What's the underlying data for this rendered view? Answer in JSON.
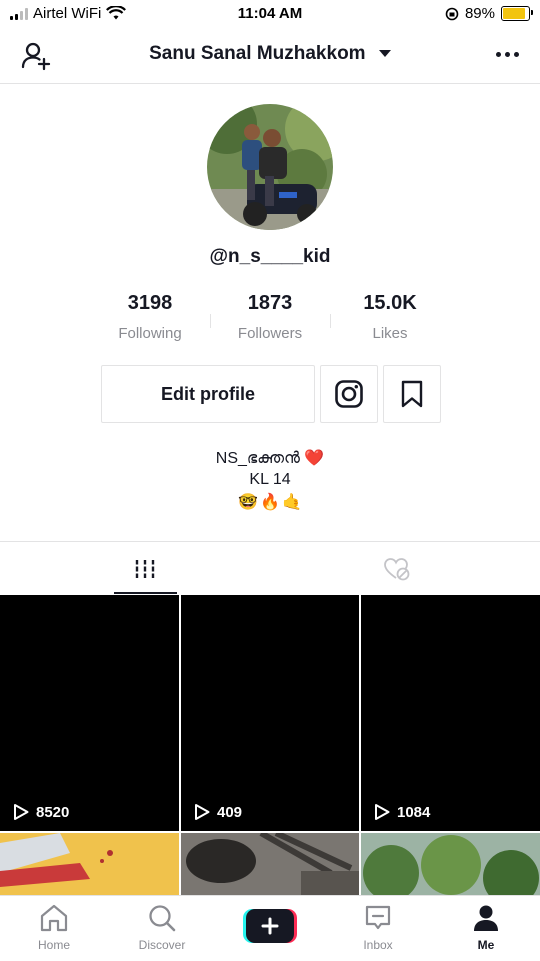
{
  "status": {
    "carrier": "Airtel WiFi",
    "time": "11:04 AM",
    "battery": "89%",
    "battery_level": 0.89
  },
  "header": {
    "title": "Sanu Sanal Muzhakkom"
  },
  "profile": {
    "username": "@n_s____kid",
    "stats": [
      {
        "value": "3198",
        "label": "Following"
      },
      {
        "value": "1873",
        "label": "Followers"
      },
      {
        "value": "15.0K",
        "label": "Likes"
      }
    ],
    "edit_label": "Edit profile",
    "bio_line1": "NS_ഭക്തൻ ❤️",
    "bio_line2": "KL 14",
    "bio_emojis": [
      "🤓",
      "🔥",
      "🤙"
    ]
  },
  "videos": [
    {
      "views": "8520"
    },
    {
      "views": "409"
    },
    {
      "views": "1084"
    }
  ],
  "nav": {
    "home": "Home",
    "discover": "Discover",
    "inbox": "Inbox",
    "me": "Me"
  },
  "colors": {
    "accent_cyan": "#25F4EE",
    "accent_red": "#FE2C55",
    "battery": "#F2C40F",
    "text": "#161823",
    "muted": "#8A8B91"
  },
  "icons": [
    "add-user-icon",
    "caret-down-icon",
    "more-icon",
    "instagram-icon",
    "bookmark-icon",
    "grid-icon",
    "liked-hidden-icon",
    "play-icon",
    "home-icon",
    "discover-icon",
    "create-icon",
    "inbox-icon",
    "me-icon"
  ]
}
